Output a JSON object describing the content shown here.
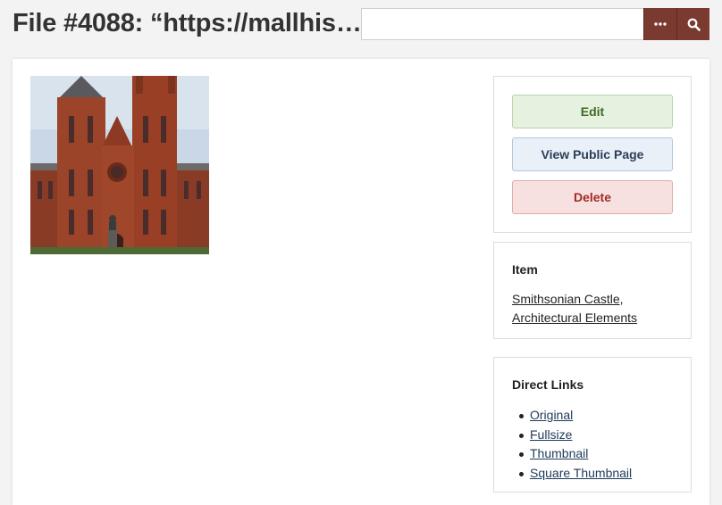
{
  "header": {
    "title": "File #4088: “https://mallhis…",
    "search": {
      "value": "",
      "placeholder": ""
    },
    "advanced_icon": "ellipsis-icon",
    "search_icon": "search-icon"
  },
  "file": {
    "thumbnail_alt": "Smithsonian Castle"
  },
  "actions": {
    "edit_label": "Edit",
    "view_label": "View Public Page",
    "delete_label": "Delete"
  },
  "item": {
    "heading": "Item",
    "link_text": "Smithsonian Castle, Architectural Elements"
  },
  "direct_links": {
    "heading": "Direct Links",
    "links": [
      "Original",
      "Fullsize",
      "Thumbnail",
      "Square Thumbnail"
    ]
  },
  "colors": {
    "button_dark": "#7a3a2f",
    "edit_bg": "#e6f1df",
    "view_bg": "#e9f0f8",
    "delete_bg": "#f7e1e0"
  }
}
